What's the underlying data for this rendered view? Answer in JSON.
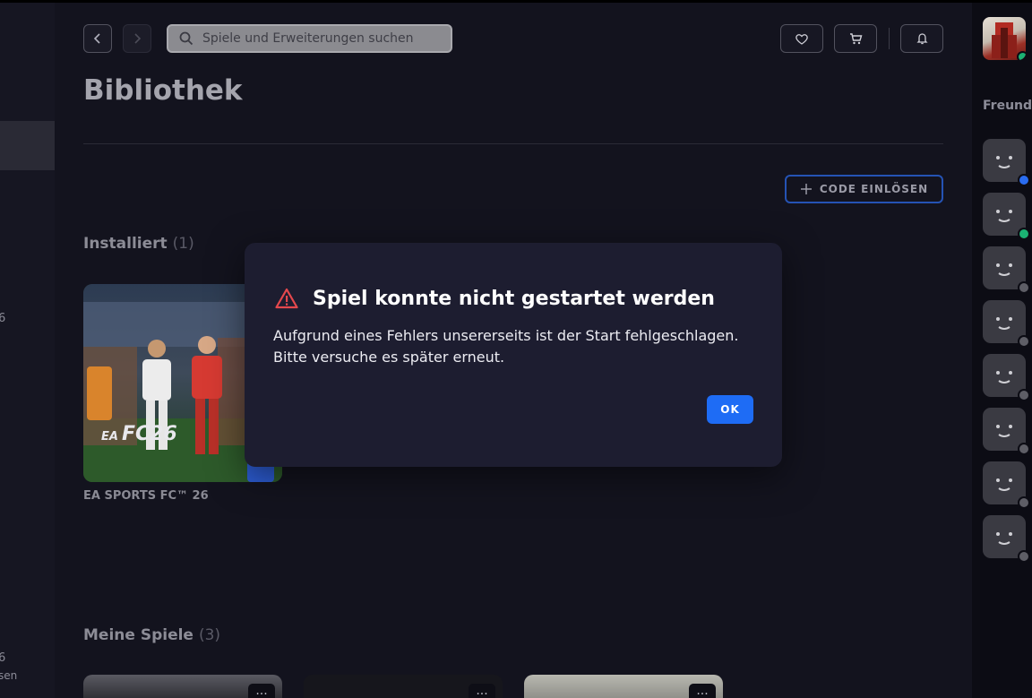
{
  "sidebar": {
    "fragments": [
      "6",
      "6",
      "sen"
    ]
  },
  "header": {
    "search_placeholder": "Spiele und Erweiterungen suchen",
    "back_icon": "chevron-left-icon",
    "forward_icon": "chevron-right-icon",
    "wishlist_icon": "heart-icon",
    "cart_icon": "cart-icon",
    "notifications_icon": "bell-icon"
  },
  "page": {
    "title": "Bibliothek",
    "redeem_code_label": "CODE EINLÖSEN"
  },
  "installed": {
    "title": "Installiert",
    "count": "(1)",
    "games": [
      {
        "title": "EA SPORTS FC™ 26",
        "logo_text": "FC26",
        "publisher_text": "EA"
      }
    ]
  },
  "my_games": {
    "title": "Meine Spiele",
    "count": "(3)",
    "more_label": "..."
  },
  "friends": {
    "label": "Freunde",
    "statuses": [
      "away",
      "online",
      "offline",
      "offline",
      "offline",
      "offline",
      "offline",
      "offline"
    ]
  },
  "dialog": {
    "title": "Spiel konnte nicht gestartet werden",
    "message": "Aufgrund eines Fehlers unsererseits ist der Start fehlgeschlagen. Bitte versuche es später erneut.",
    "ok_label": "OK",
    "icon": "warning-icon"
  },
  "colors": {
    "accent": "#1e6cf5",
    "warning": "#e5484d",
    "online": "#1bb273",
    "away": "#2a6cf0",
    "offline": "#5e5e66"
  }
}
